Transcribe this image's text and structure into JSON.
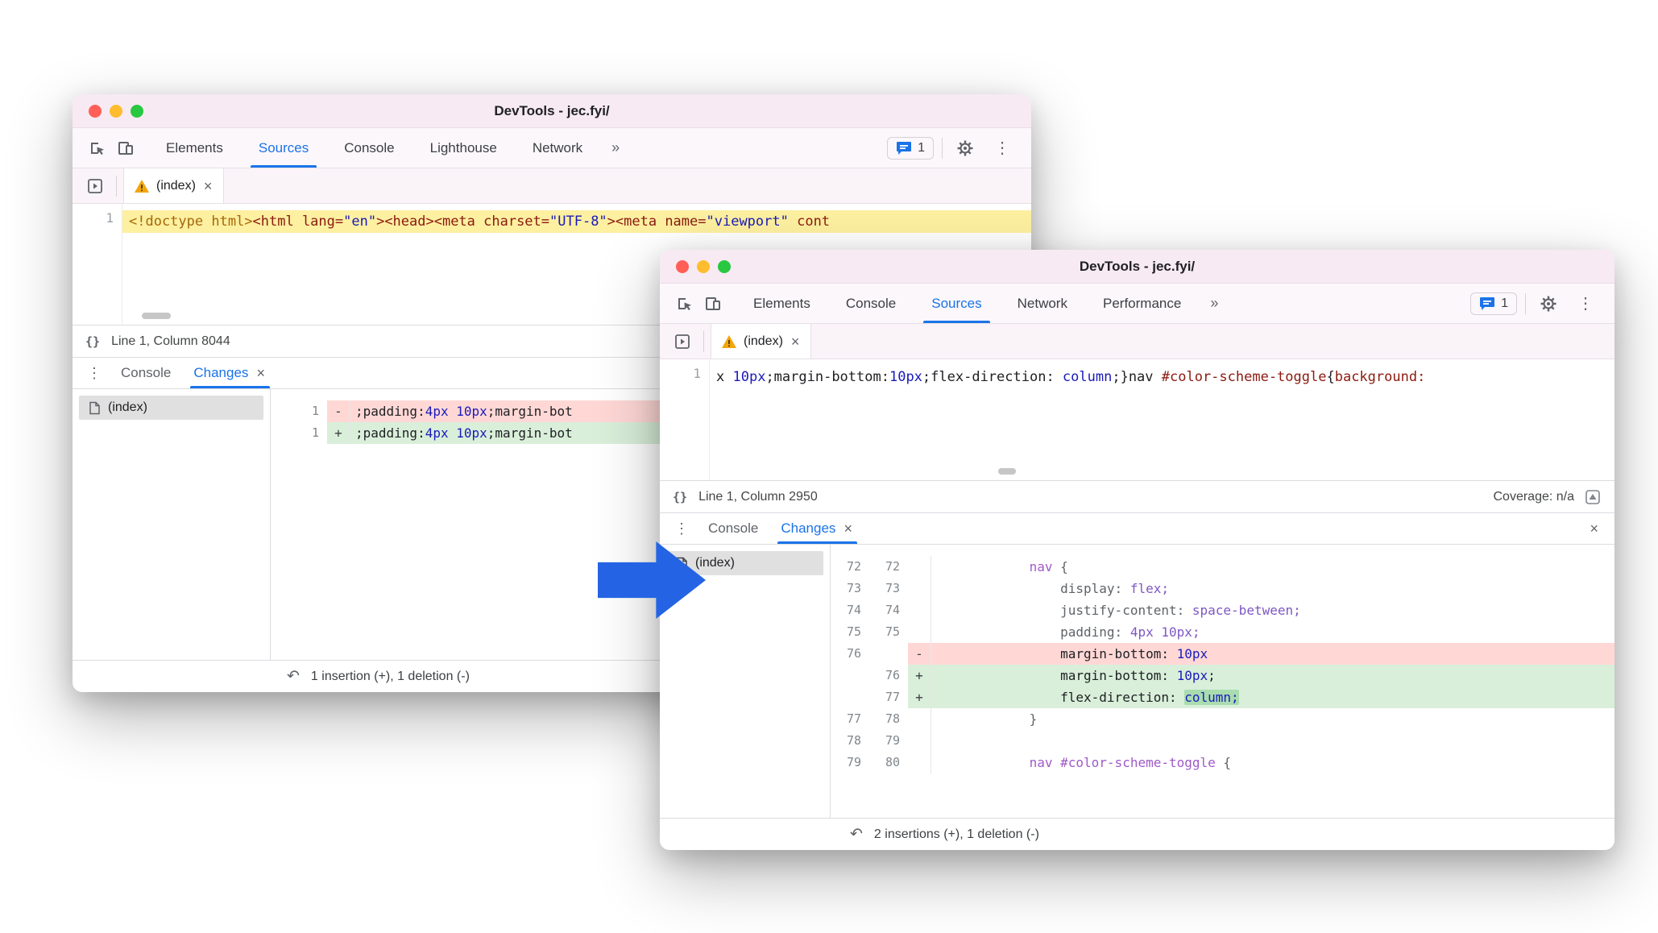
{
  "colors": {
    "accent_blue": "#1a73e8",
    "titlebar_pink": "#f7eaf3",
    "highlight_yellow": "#fdf0a0",
    "diff_delete_bg": "#ffd8d6",
    "diff_insert_bg": "#d9efda",
    "diff_insert_chip": "#a9dcae",
    "arrow_blue": "#2464e4",
    "traffic_red": "#ff5f57",
    "traffic_yellow": "#febc2e",
    "traffic_green": "#28c840"
  },
  "back": {
    "title": "DevTools - jec.fyi/",
    "toolbar": {
      "t0": "Elements",
      "t1": "Sources",
      "t2": "Console",
      "t3": "Lighthouse",
      "t4": "Network",
      "more": "»",
      "issues": "1"
    },
    "file_tab": {
      "label": "(index)",
      "close": "×"
    },
    "editor": {
      "line_no": "1",
      "s0": "<!doctype html>",
      "s1": "<html lang=",
      "s2": "\"en\"",
      "s3": "><head><meta charset=",
      "s4": "\"UTF-8\"",
      "s5": "><meta name=",
      "s6": "\"viewport\"",
      "s7": " cont"
    },
    "status": {
      "braces": "{}",
      "text": "Line 1, Column 8044"
    },
    "drawer": {
      "menu": "⋮",
      "tab_console": "Console",
      "tab_changes": "Changes",
      "tab_close": "×",
      "file": "(index)",
      "diff": {
        "r0": {
          "num": "1",
          "marker": "-",
          "c0": ";padding:",
          "c1": "4px",
          "c2": " ",
          "c3": "10px",
          "c4": ";margin-bot"
        },
        "r1": {
          "num": "1",
          "marker": "+",
          "c0": ";padding:",
          "c1": "4px",
          "c2": " ",
          "c3": "10px",
          "c4": ";margin-bot"
        }
      },
      "summary_icon": "↶",
      "summary": "1 insertion (+), 1 deletion (-)"
    }
  },
  "front": {
    "title": "DevTools - jec.fyi/",
    "toolbar": {
      "t0": "Elements",
      "t1": "Console",
      "t2": "Sources",
      "t3": "Network",
      "t4": "Performance",
      "more": "»",
      "issues": "1"
    },
    "file_tab": {
      "label": "(index)",
      "close": "×"
    },
    "editor": {
      "line_no": "1",
      "s0": "x ",
      "s1": "10px",
      "s2": ";margin-bottom:",
      "s3": "10px",
      "s4": ";flex-direction: ",
      "s5": "column",
      "s6": ";}nav ",
      "s7": "#color-scheme-toggle",
      "s8": "{",
      "s9": "background:"
    },
    "status": {
      "braces": "{}",
      "text": "Line 1, Column 2950",
      "coverage": "Coverage: n/a"
    },
    "drawer": {
      "menu": "⋮",
      "tab_console": "Console",
      "tab_changes": "Changes",
      "tab_close": "×",
      "drawer_close": "×",
      "file": "(index)",
      "diff": {
        "r0": {
          "old": "72",
          "new": "72",
          "marker": "",
          "i": "            ",
          "c0": "nav",
          "c1": " {"
        },
        "r1": {
          "old": "73",
          "new": "73",
          "marker": "",
          "i": "                ",
          "c0": "display:",
          "c1": " flex;"
        },
        "r2": {
          "old": "74",
          "new": "74",
          "marker": "",
          "i": "                ",
          "c0": "justify-content:",
          "c1": " space-between;"
        },
        "r3": {
          "old": "75",
          "new": "75",
          "marker": "",
          "i": "                ",
          "c0": "padding:",
          "c1": " 4px 10px;"
        },
        "r4": {
          "old": "76",
          "new": "",
          "marker": "-",
          "i": "                ",
          "c0": "margin-bottom: ",
          "c1": "10px"
        },
        "r5": {
          "old": "",
          "new": "76",
          "marker": "+",
          "i": "                ",
          "c0": "margin-bottom: ",
          "c1": "10px",
          "c2": ";"
        },
        "r6": {
          "old": "",
          "new": "77",
          "marker": "+",
          "i": "                ",
          "c0": "flex-direction: ",
          "c1": "column;"
        },
        "r7": {
          "old": "77",
          "new": "78",
          "marker": "",
          "i": "            ",
          "c0": "}",
          "c1": ""
        },
        "r8": {
          "old": "78",
          "new": "79",
          "marker": "",
          "i": "",
          "c0": "",
          "c1": ""
        },
        "r9": {
          "old": "79",
          "new": "80",
          "marker": "",
          "i": "            ",
          "c0": "nav #color-scheme-toggle",
          "c1": " {"
        }
      },
      "summary_icon": "↶",
      "summary": "2 insertions (+), 1 deletion (-)"
    }
  }
}
